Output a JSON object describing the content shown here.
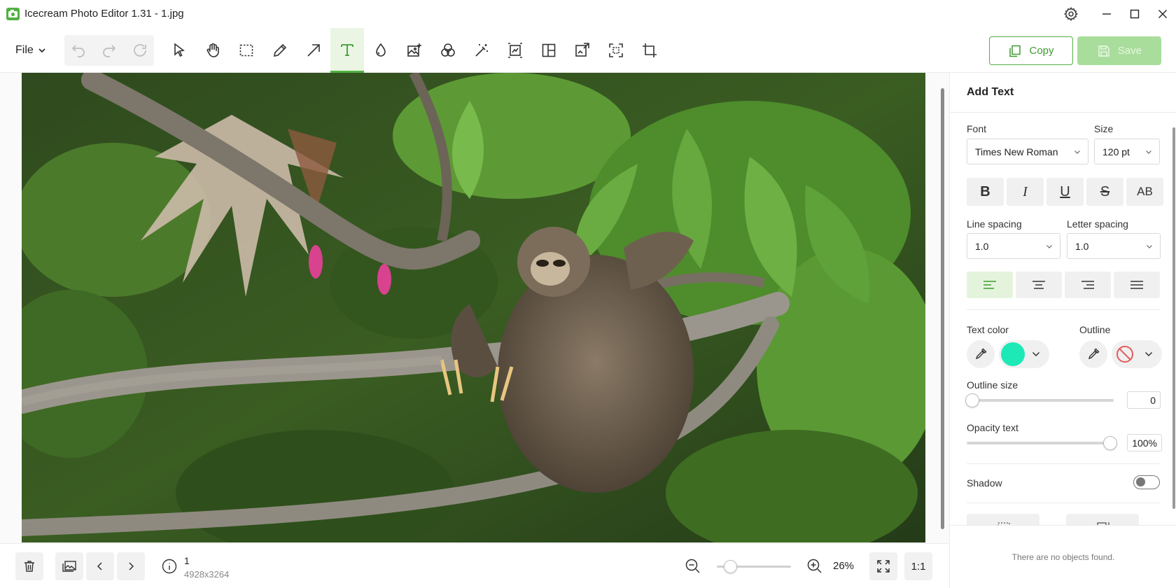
{
  "window": {
    "title": "Icecream Photo Editor 1.31 - 1.jpg",
    "icons": [
      "app-icon",
      "settings-icon",
      "minimize-icon",
      "maximize-icon",
      "close-icon"
    ]
  },
  "toolbar": {
    "file_label": "File",
    "tools": [
      "undo-icon",
      "redo-icon",
      "reset-icon",
      "select-icon",
      "hand-icon",
      "marquee-icon",
      "pencil-icon",
      "arrow-icon",
      "text-icon",
      "blur-drop-icon",
      "add-image-icon",
      "filters-icon",
      "magic-wand-icon",
      "resize-icon",
      "layout-icon",
      "watermark-icon",
      "crop-select-icon",
      "crop-icon"
    ],
    "active_tool": "text-icon",
    "copy_label": "Copy",
    "save_label": "Save"
  },
  "canvas": {
    "image_description_alt": "photo"
  },
  "bottombar": {
    "image_index": "1",
    "image_dimensions": "4928x3264",
    "zoom": "26%",
    "fit_label": "1:1",
    "zoom_level": 0.12
  },
  "panel": {
    "title": "Add Text",
    "font_label": "Font",
    "font_value": "Times New Roman",
    "size_label": "Size",
    "size_value": "120 pt",
    "format_buttons": [
      "B",
      "I",
      "U",
      "S",
      "AB"
    ],
    "line_spacing_label": "Line spacing",
    "line_spacing_value": "1.0",
    "letter_spacing_label": "Letter spacing",
    "letter_spacing_value": "1.0",
    "alignment": [
      "left",
      "center",
      "right",
      "justify"
    ],
    "active_alignment": "left",
    "text_color_label": "Text color",
    "text_color": "#1de9b6",
    "outline_label": "Outline",
    "outline_color": "none",
    "outline_size_label": "Outline size",
    "outline_size_value": "0",
    "opacity_label": "Opacity text",
    "opacity_value": "100%",
    "shadow_label": "Shadow",
    "shadow_on": false,
    "no_objects_text": "There are no objects found."
  },
  "colors": {
    "accent": "#52b043",
    "accent_light": "#eaf6e3",
    "save_disabled": "#a9dd9c"
  }
}
